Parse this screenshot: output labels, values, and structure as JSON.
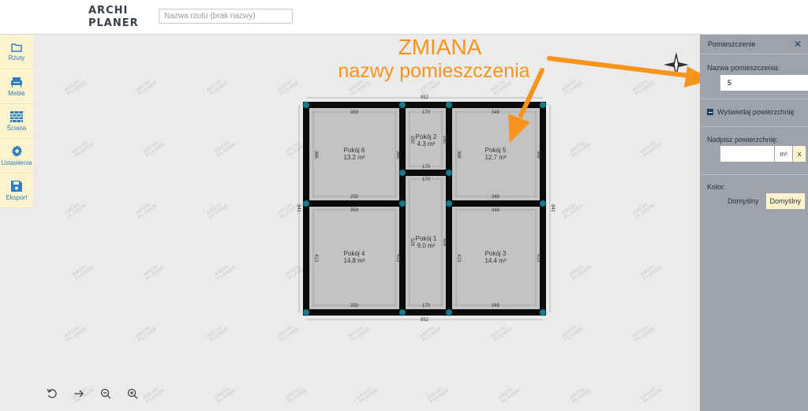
{
  "app": {
    "logo_line1": "ARCHI",
    "logo_line2": "PLANER"
  },
  "header": {
    "plan_name_placeholder": "Nazwa rzutu (brak nazwy)"
  },
  "sidebar": {
    "items": [
      {
        "label": "Rzuty",
        "icon": "folder-icon"
      },
      {
        "label": "Meble",
        "icon": "armchair-icon"
      },
      {
        "label": "Ściana",
        "icon": "brick-wall-icon"
      },
      {
        "label": "Ustawienia",
        "icon": "gear-icon"
      },
      {
        "label": "Eksport",
        "icon": "floppy-disk-icon"
      }
    ]
  },
  "watermark": {
    "line1": "ARCHI",
    "line2": "PLANER"
  },
  "annotation": {
    "title": "ZMIANA",
    "subtitle": "nazwy pomieszczenia",
    "color": "#f7941d"
  },
  "plan": {
    "dimensions": {
      "top_total": "952",
      "bottom_total": "952",
      "left_total": "841",
      "right_total": "841",
      "r6_width": "359",
      "r2_width": "170",
      "r5_width": "348",
      "r6_height": "366",
      "r2_height": "250",
      "r5_height": "366",
      "corridor_top": "170",
      "corridor_height": "528",
      "r4_width": "359",
      "r3_width": "348",
      "r4_height": "413",
      "r3_height": "413",
      "bottom_r4": "359",
      "bottom_corridor": "170",
      "bottom_r3": "348"
    },
    "rooms": [
      {
        "name": "Pokój 6",
        "area": "13.2 m²"
      },
      {
        "name": "Pokój 2",
        "area": "4.3 m²"
      },
      {
        "name": "Pokój 5",
        "area": "12.7 m²"
      },
      {
        "name": "Pokój 1",
        "area": "9.0 m²"
      },
      {
        "name": "Pokój 4",
        "area": "14.8 m²"
      },
      {
        "name": "Pokój 3",
        "area": "14.4 m²"
      }
    ]
  },
  "panel": {
    "title": "Pomieszczenie",
    "room_name_label": "Nazwa pomieszczenia:",
    "room_name_value": "5",
    "show_area_label": "Wyświetlaj powierzchnię",
    "override_area_label": "Nadpisz powierzchnię:",
    "unit": "m²",
    "clear": "x",
    "color_label": "Kolor:",
    "color_current": "Domyślny",
    "color_button": "Domyślny"
  },
  "toolbar": {
    "undo_icon": "undo-icon",
    "redo_icon": "redo-icon",
    "zoom_out_icon": "zoom-out-icon",
    "zoom_in_icon": "zoom-in-icon"
  }
}
